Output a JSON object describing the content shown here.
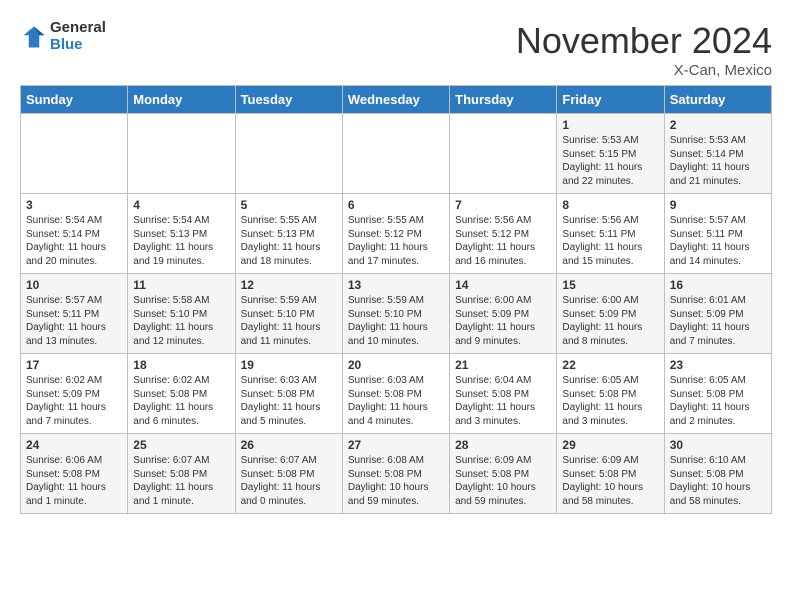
{
  "header": {
    "logo_general": "General",
    "logo_blue": "Blue",
    "month_title": "November 2024",
    "location": "X-Can, Mexico"
  },
  "weekdays": [
    "Sunday",
    "Monday",
    "Tuesday",
    "Wednesday",
    "Thursday",
    "Friday",
    "Saturday"
  ],
  "weeks": [
    [
      {
        "day": "",
        "info": ""
      },
      {
        "day": "",
        "info": ""
      },
      {
        "day": "",
        "info": ""
      },
      {
        "day": "",
        "info": ""
      },
      {
        "day": "",
        "info": ""
      },
      {
        "day": "1",
        "info": "Sunrise: 5:53 AM\nSunset: 5:15 PM\nDaylight: 11 hours\nand 22 minutes."
      },
      {
        "day": "2",
        "info": "Sunrise: 5:53 AM\nSunset: 5:14 PM\nDaylight: 11 hours\nand 21 minutes."
      }
    ],
    [
      {
        "day": "3",
        "info": "Sunrise: 5:54 AM\nSunset: 5:14 PM\nDaylight: 11 hours\nand 20 minutes."
      },
      {
        "day": "4",
        "info": "Sunrise: 5:54 AM\nSunset: 5:13 PM\nDaylight: 11 hours\nand 19 minutes."
      },
      {
        "day": "5",
        "info": "Sunrise: 5:55 AM\nSunset: 5:13 PM\nDaylight: 11 hours\nand 18 minutes."
      },
      {
        "day": "6",
        "info": "Sunrise: 5:55 AM\nSunset: 5:12 PM\nDaylight: 11 hours\nand 17 minutes."
      },
      {
        "day": "7",
        "info": "Sunrise: 5:56 AM\nSunset: 5:12 PM\nDaylight: 11 hours\nand 16 minutes."
      },
      {
        "day": "8",
        "info": "Sunrise: 5:56 AM\nSunset: 5:11 PM\nDaylight: 11 hours\nand 15 minutes."
      },
      {
        "day": "9",
        "info": "Sunrise: 5:57 AM\nSunset: 5:11 PM\nDaylight: 11 hours\nand 14 minutes."
      }
    ],
    [
      {
        "day": "10",
        "info": "Sunrise: 5:57 AM\nSunset: 5:11 PM\nDaylight: 11 hours\nand 13 minutes."
      },
      {
        "day": "11",
        "info": "Sunrise: 5:58 AM\nSunset: 5:10 PM\nDaylight: 11 hours\nand 12 minutes."
      },
      {
        "day": "12",
        "info": "Sunrise: 5:59 AM\nSunset: 5:10 PM\nDaylight: 11 hours\nand 11 minutes."
      },
      {
        "day": "13",
        "info": "Sunrise: 5:59 AM\nSunset: 5:10 PM\nDaylight: 11 hours\nand 10 minutes."
      },
      {
        "day": "14",
        "info": "Sunrise: 6:00 AM\nSunset: 5:09 PM\nDaylight: 11 hours\nand 9 minutes."
      },
      {
        "day": "15",
        "info": "Sunrise: 6:00 AM\nSunset: 5:09 PM\nDaylight: 11 hours\nand 8 minutes."
      },
      {
        "day": "16",
        "info": "Sunrise: 6:01 AM\nSunset: 5:09 PM\nDaylight: 11 hours\nand 7 minutes."
      }
    ],
    [
      {
        "day": "17",
        "info": "Sunrise: 6:02 AM\nSunset: 5:09 PM\nDaylight: 11 hours\nand 7 minutes."
      },
      {
        "day": "18",
        "info": "Sunrise: 6:02 AM\nSunset: 5:08 PM\nDaylight: 11 hours\nand 6 minutes."
      },
      {
        "day": "19",
        "info": "Sunrise: 6:03 AM\nSunset: 5:08 PM\nDaylight: 11 hours\nand 5 minutes."
      },
      {
        "day": "20",
        "info": "Sunrise: 6:03 AM\nSunset: 5:08 PM\nDaylight: 11 hours\nand 4 minutes."
      },
      {
        "day": "21",
        "info": "Sunrise: 6:04 AM\nSunset: 5:08 PM\nDaylight: 11 hours\nand 3 minutes."
      },
      {
        "day": "22",
        "info": "Sunrise: 6:05 AM\nSunset: 5:08 PM\nDaylight: 11 hours\nand 3 minutes."
      },
      {
        "day": "23",
        "info": "Sunrise: 6:05 AM\nSunset: 5:08 PM\nDaylight: 11 hours\nand 2 minutes."
      }
    ],
    [
      {
        "day": "24",
        "info": "Sunrise: 6:06 AM\nSunset: 5:08 PM\nDaylight: 11 hours\nand 1 minute."
      },
      {
        "day": "25",
        "info": "Sunrise: 6:07 AM\nSunset: 5:08 PM\nDaylight: 11 hours\nand 1 minute."
      },
      {
        "day": "26",
        "info": "Sunrise: 6:07 AM\nSunset: 5:08 PM\nDaylight: 11 hours\nand 0 minutes."
      },
      {
        "day": "27",
        "info": "Sunrise: 6:08 AM\nSunset: 5:08 PM\nDaylight: 10 hours\nand 59 minutes."
      },
      {
        "day": "28",
        "info": "Sunrise: 6:09 AM\nSunset: 5:08 PM\nDaylight: 10 hours\nand 59 minutes."
      },
      {
        "day": "29",
        "info": "Sunrise: 6:09 AM\nSunset: 5:08 PM\nDaylight: 10 hours\nand 58 minutes."
      },
      {
        "day": "30",
        "info": "Sunrise: 6:10 AM\nSunset: 5:08 PM\nDaylight: 10 hours\nand 58 minutes."
      }
    ]
  ]
}
